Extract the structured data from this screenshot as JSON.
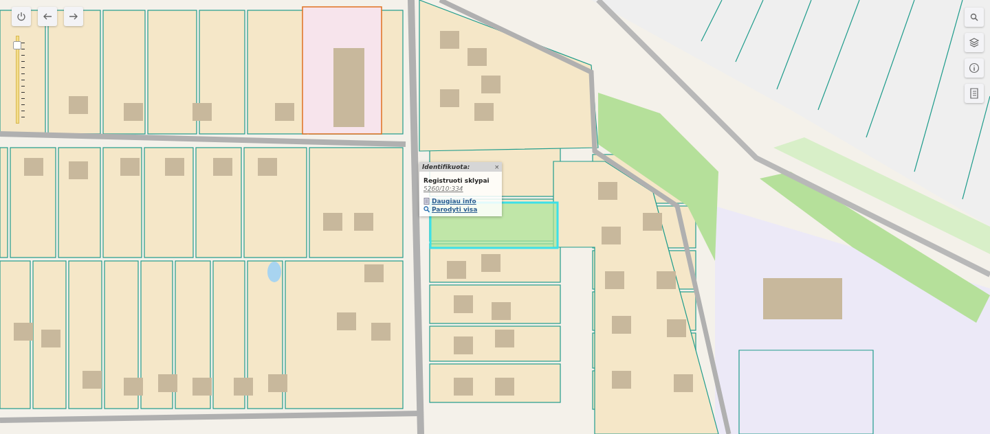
{
  "zoom_slider": {
    "level": 0.9
  },
  "popup": {
    "title": "Identifikuota:",
    "close": "×",
    "layer": "Registruoti sklypai",
    "parcel_id": "5260/10:334",
    "links": [
      {
        "kind": "info",
        "label": "Daugiau info"
      },
      {
        "kind": "zoom",
        "label": "Parodyti visa"
      }
    ]
  }
}
